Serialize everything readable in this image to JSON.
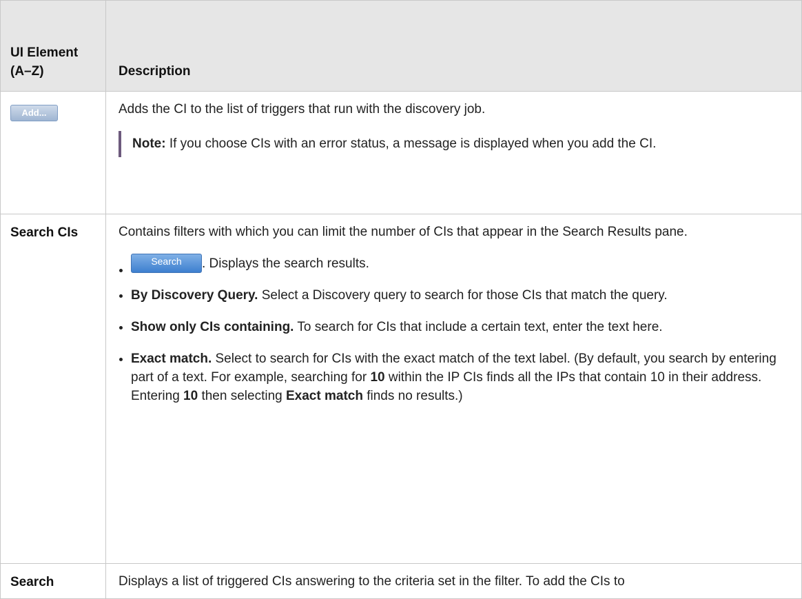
{
  "table": {
    "header": {
      "ui_element": "UI Element (A–Z)",
      "description": "Description"
    },
    "rows": [
      {
        "button_label": "Add...",
        "description": "Adds the CI to the list of triggers that run with the discovery job.",
        "note_label": "Note:",
        "note_text": "If you choose CIs with an error status, a message is displayed when you add the CI."
      },
      {
        "ui_element": "Search CIs",
        "description": "Contains filters with which you can limit the number of CIs that appear in the Search Results pane.",
        "items": [
          {
            "button_label": "Search",
            "text": ". Displays the search results."
          },
          {
            "bold": "By Discovery Query.",
            "text": " Select a Discovery query to search for those CIs that match the query."
          },
          {
            "bold": "Show only CIs containing.",
            "text": " To search for CIs that include a certain text, enter the text here."
          },
          {
            "bold": "Exact match.",
            "text_1": " Select to search for CIs with the exact match of the text label. (By default, you search by entering part of a text. For example, searching for ",
            "bold_2": "10",
            "text_2": " within the IP CIs finds all the IPs that contain 10 in their address. Entering ",
            "bold_3": "10",
            "text_3": " then selecting ",
            "bold_4": "Exact match",
            "text_4": " finds no results.)"
          }
        ]
      },
      {
        "ui_element": "Search",
        "description": "Displays a list of triggered CIs answering to the criteria set in the filter. To add the CIs to"
      }
    ]
  },
  "colors": {
    "header_bg": "#e6e6e6",
    "border": "#c8c8c8",
    "note_bar": "#6d5a7d",
    "search_button": "#3d7fcf"
  }
}
